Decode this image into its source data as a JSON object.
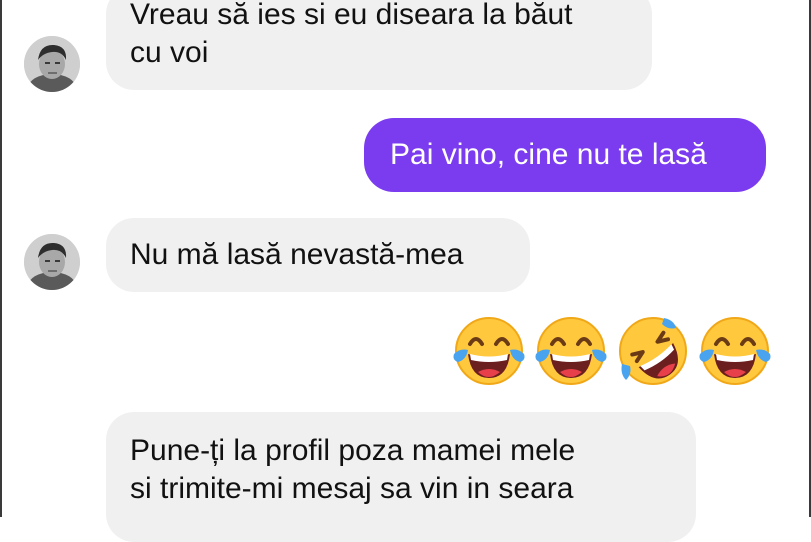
{
  "conversation": {
    "messages": [
      {
        "sender": "them",
        "lines": [
          "Vreau să ies si eu diseara la băut",
          "cu voi"
        ]
      },
      {
        "sender": "me",
        "lines": [
          "Pai vino, cine nu te lasă"
        ]
      },
      {
        "sender": "them",
        "lines": [
          "Nu mă lasă nevastă-mea"
        ]
      },
      {
        "sender": "me",
        "emojis": [
          "face-with-tears-of-joy",
          "face-with-tears-of-joy",
          "rolling-on-the-floor-laughing",
          "face-with-tears-of-joy"
        ]
      },
      {
        "sender": "them",
        "lines": [
          "Pune-ți la profil poza mamei mele",
          "si trimite-mi mesaj sa vin in seara"
        ]
      }
    ]
  },
  "colors": {
    "incoming_bubble": "#f1f0f0",
    "outgoing_bubble": "#7b3cf0",
    "emoji_yellow": "#ffc83d"
  }
}
